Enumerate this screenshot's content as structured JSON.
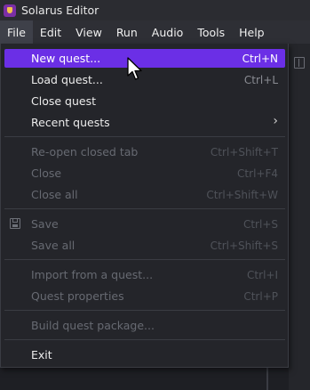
{
  "window": {
    "title": "Solarus Editor",
    "icon": "solarus-logo-icon",
    "accent": "#6b2fe6"
  },
  "menubar": {
    "items": [
      {
        "label": "File",
        "active": true
      },
      {
        "label": "Edit"
      },
      {
        "label": "View"
      },
      {
        "label": "Run"
      },
      {
        "label": "Audio"
      },
      {
        "label": "Tools"
      },
      {
        "label": "Help"
      }
    ]
  },
  "file_menu": {
    "new_quest": {
      "label": "New quest...",
      "shortcut": "Ctrl+N"
    },
    "load_quest": {
      "label": "Load quest...",
      "shortcut": "Ctrl+L"
    },
    "close_quest": {
      "label": "Close quest"
    },
    "recent_quests": {
      "label": "Recent quests",
      "submenu_icon": "chevron-right-icon"
    },
    "reopen_closed_tab": {
      "label": "Re-open closed tab",
      "shortcut": "Ctrl+Shift+T"
    },
    "close": {
      "label": "Close",
      "shortcut": "Ctrl+F4"
    },
    "close_all": {
      "label": "Close all",
      "shortcut": "Ctrl+Shift+W"
    },
    "save": {
      "label": "Save",
      "shortcut": "Ctrl+S",
      "icon": "save-icon"
    },
    "save_all": {
      "label": "Save all",
      "shortcut": "Ctrl+Shift+S"
    },
    "import_from_quest": {
      "label": "Import from a quest...",
      "shortcut": "Ctrl+I"
    },
    "quest_properties": {
      "label": "Quest properties",
      "shortcut": "Ctrl+P"
    },
    "build_quest_package": {
      "label": "Build quest package..."
    },
    "exit": {
      "label": "Exit"
    }
  }
}
